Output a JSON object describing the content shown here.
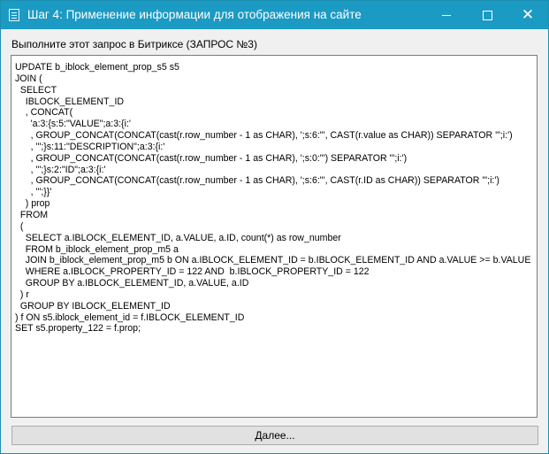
{
  "window": {
    "title": "Шаг 4: Применение информации для отображения на сайте",
    "controls": {
      "minimize": "—",
      "maximize": "☐",
      "close": "✕"
    }
  },
  "instruction": "Выполните этот запрос в Битриксе (ЗАПРОС №3)",
  "sql": "UPDATE b_iblock_element_prop_s5 s5\nJOIN (\n  SELECT\n    IBLOCK_ELEMENT_ID\n    , CONCAT(\n      'a:3:{s:5:\"VALUE\";a:3:{i:'\n      , GROUP_CONCAT(CONCAT(cast(r.row_number - 1 as CHAR), ';s:6:\"', CAST(r.value as CHAR)) SEPARATOR '\";i:')\n      , '\";}s:11:\"DESCRIPTION\";a:3:{i:'\n      , GROUP_CONCAT(CONCAT(cast(r.row_number - 1 as CHAR), ';s:0:\"') SEPARATOR '\";i:')\n      , '\";}s:2:\"ID\";a:3:{i:'\n      , GROUP_CONCAT(CONCAT(cast(r.row_number - 1 as CHAR), ';s:6:\"', CAST(r.ID as CHAR)) SEPARATOR '\";i:')\n      , '\";}}'\n    ) prop\n  FROM\n  (\n    SELECT a.IBLOCK_ELEMENT_ID, a.VALUE, a.ID, count(*) as row_number\n    FROM b_iblock_element_prop_m5 a\n    JOIN b_iblock_element_prop_m5 b ON a.IBLOCK_ELEMENT_ID = b.IBLOCK_ELEMENT_ID AND a.VALUE >= b.VALUE\n    WHERE a.IBLOCK_PROPERTY_ID = 122 AND  b.IBLOCK_PROPERTY_ID = 122\n    GROUP BY a.IBLOCK_ELEMENT_ID, a.VALUE, a.ID\n  ) r\n  GROUP BY IBLOCK_ELEMENT_ID\n) f ON s5.iblock_element_id = f.IBLOCK_ELEMENT_ID\nSET s5.property_122 = f.prop;",
  "buttons": {
    "next": "Далее..."
  },
  "icons": {
    "app": "window-app-icon"
  },
  "colors": {
    "titlebar": "#1b9ac4",
    "window_bg": "#f0f0f0",
    "button_bg": "#e1e1e1"
  }
}
